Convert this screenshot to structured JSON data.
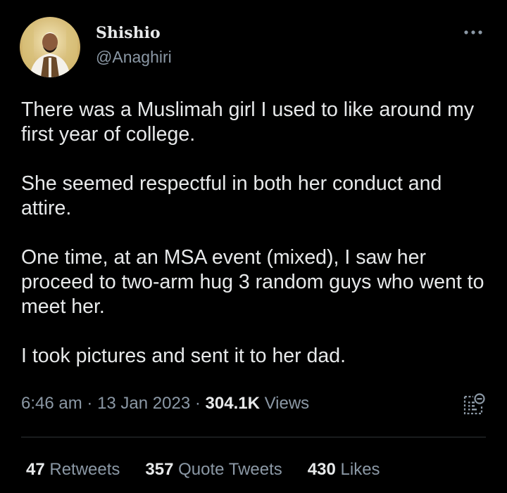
{
  "author": {
    "display_name": "Shishio",
    "handle": "@Anaghiri"
  },
  "tweet": {
    "paragraphs": [
      "There was a Muslimah girl I used to like around my first year of college.",
      "She seemed respectful in both her conduct and attire.",
      "One time, at an MSA event (mixed), I saw her proceed to two-arm hug 3 random guys who went to meet her.",
      "I took pictures and sent it to her dad."
    ]
  },
  "meta": {
    "time": "6:46 am",
    "separator": "·",
    "date": "13 Jan 2023",
    "views_count": "304.1K",
    "views_label": "Views"
  },
  "stats": {
    "retweets_count": "47",
    "retweets_label": "Retweets",
    "quotes_count": "357",
    "quotes_label": "Quote Tweets",
    "likes_count": "430",
    "likes_label": "Likes"
  },
  "icons": {
    "more": "more-horizontal-icon",
    "analytics": "analytics-icon"
  },
  "colors": {
    "background": "#000000",
    "text_primary": "#e7e9ea",
    "text_secondary": "#8b98a5",
    "divider": "#2f3336"
  }
}
